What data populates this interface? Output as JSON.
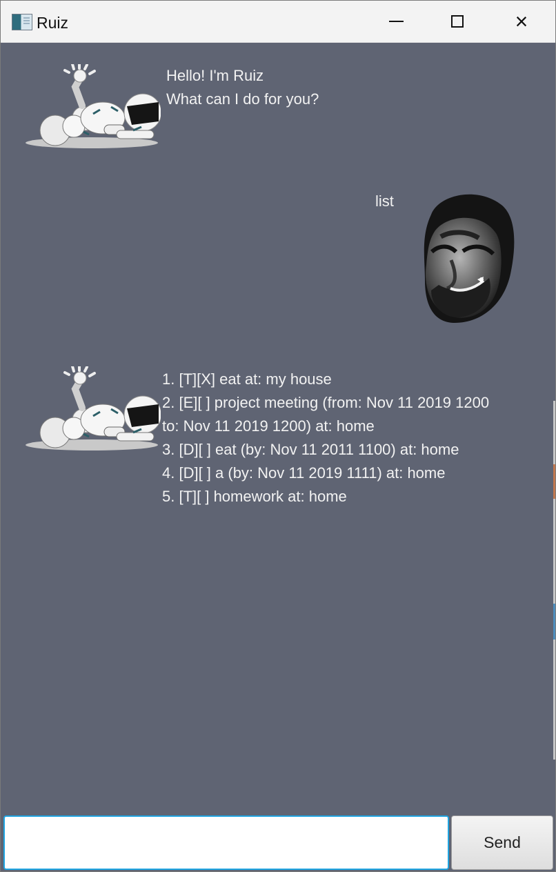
{
  "window": {
    "title": "Ruiz",
    "icons": [
      "app-window-icon",
      "minimize-icon",
      "maximize-icon",
      "close-icon"
    ],
    "close_glyph": "×"
  },
  "chat": {
    "background": "#5f6473",
    "messages": [
      {
        "sender": "bot",
        "text": "Hello! I'm Ruiz\nWhat can I do for you?"
      },
      {
        "sender": "user",
        "text": "list"
      },
      {
        "sender": "bot",
        "text": "1. [T][X] eat at: my house\n2. [E][ ] project meeting (from: Nov 11 2019 1200\nto: Nov 11 2019 1200) at: home\n3. [D][ ] eat (by: Nov 11 2011 1100) at: home\n4. [D][ ] a (by: Nov 11 2019 1111) at: home\n5. [T][ ] homework at: home"
      }
    ]
  },
  "input": {
    "value": "",
    "placeholder": ""
  },
  "send_button": {
    "label": "Send"
  },
  "colors": {
    "input_focus": "#1fa4e1",
    "text": "#f2f2f2"
  }
}
